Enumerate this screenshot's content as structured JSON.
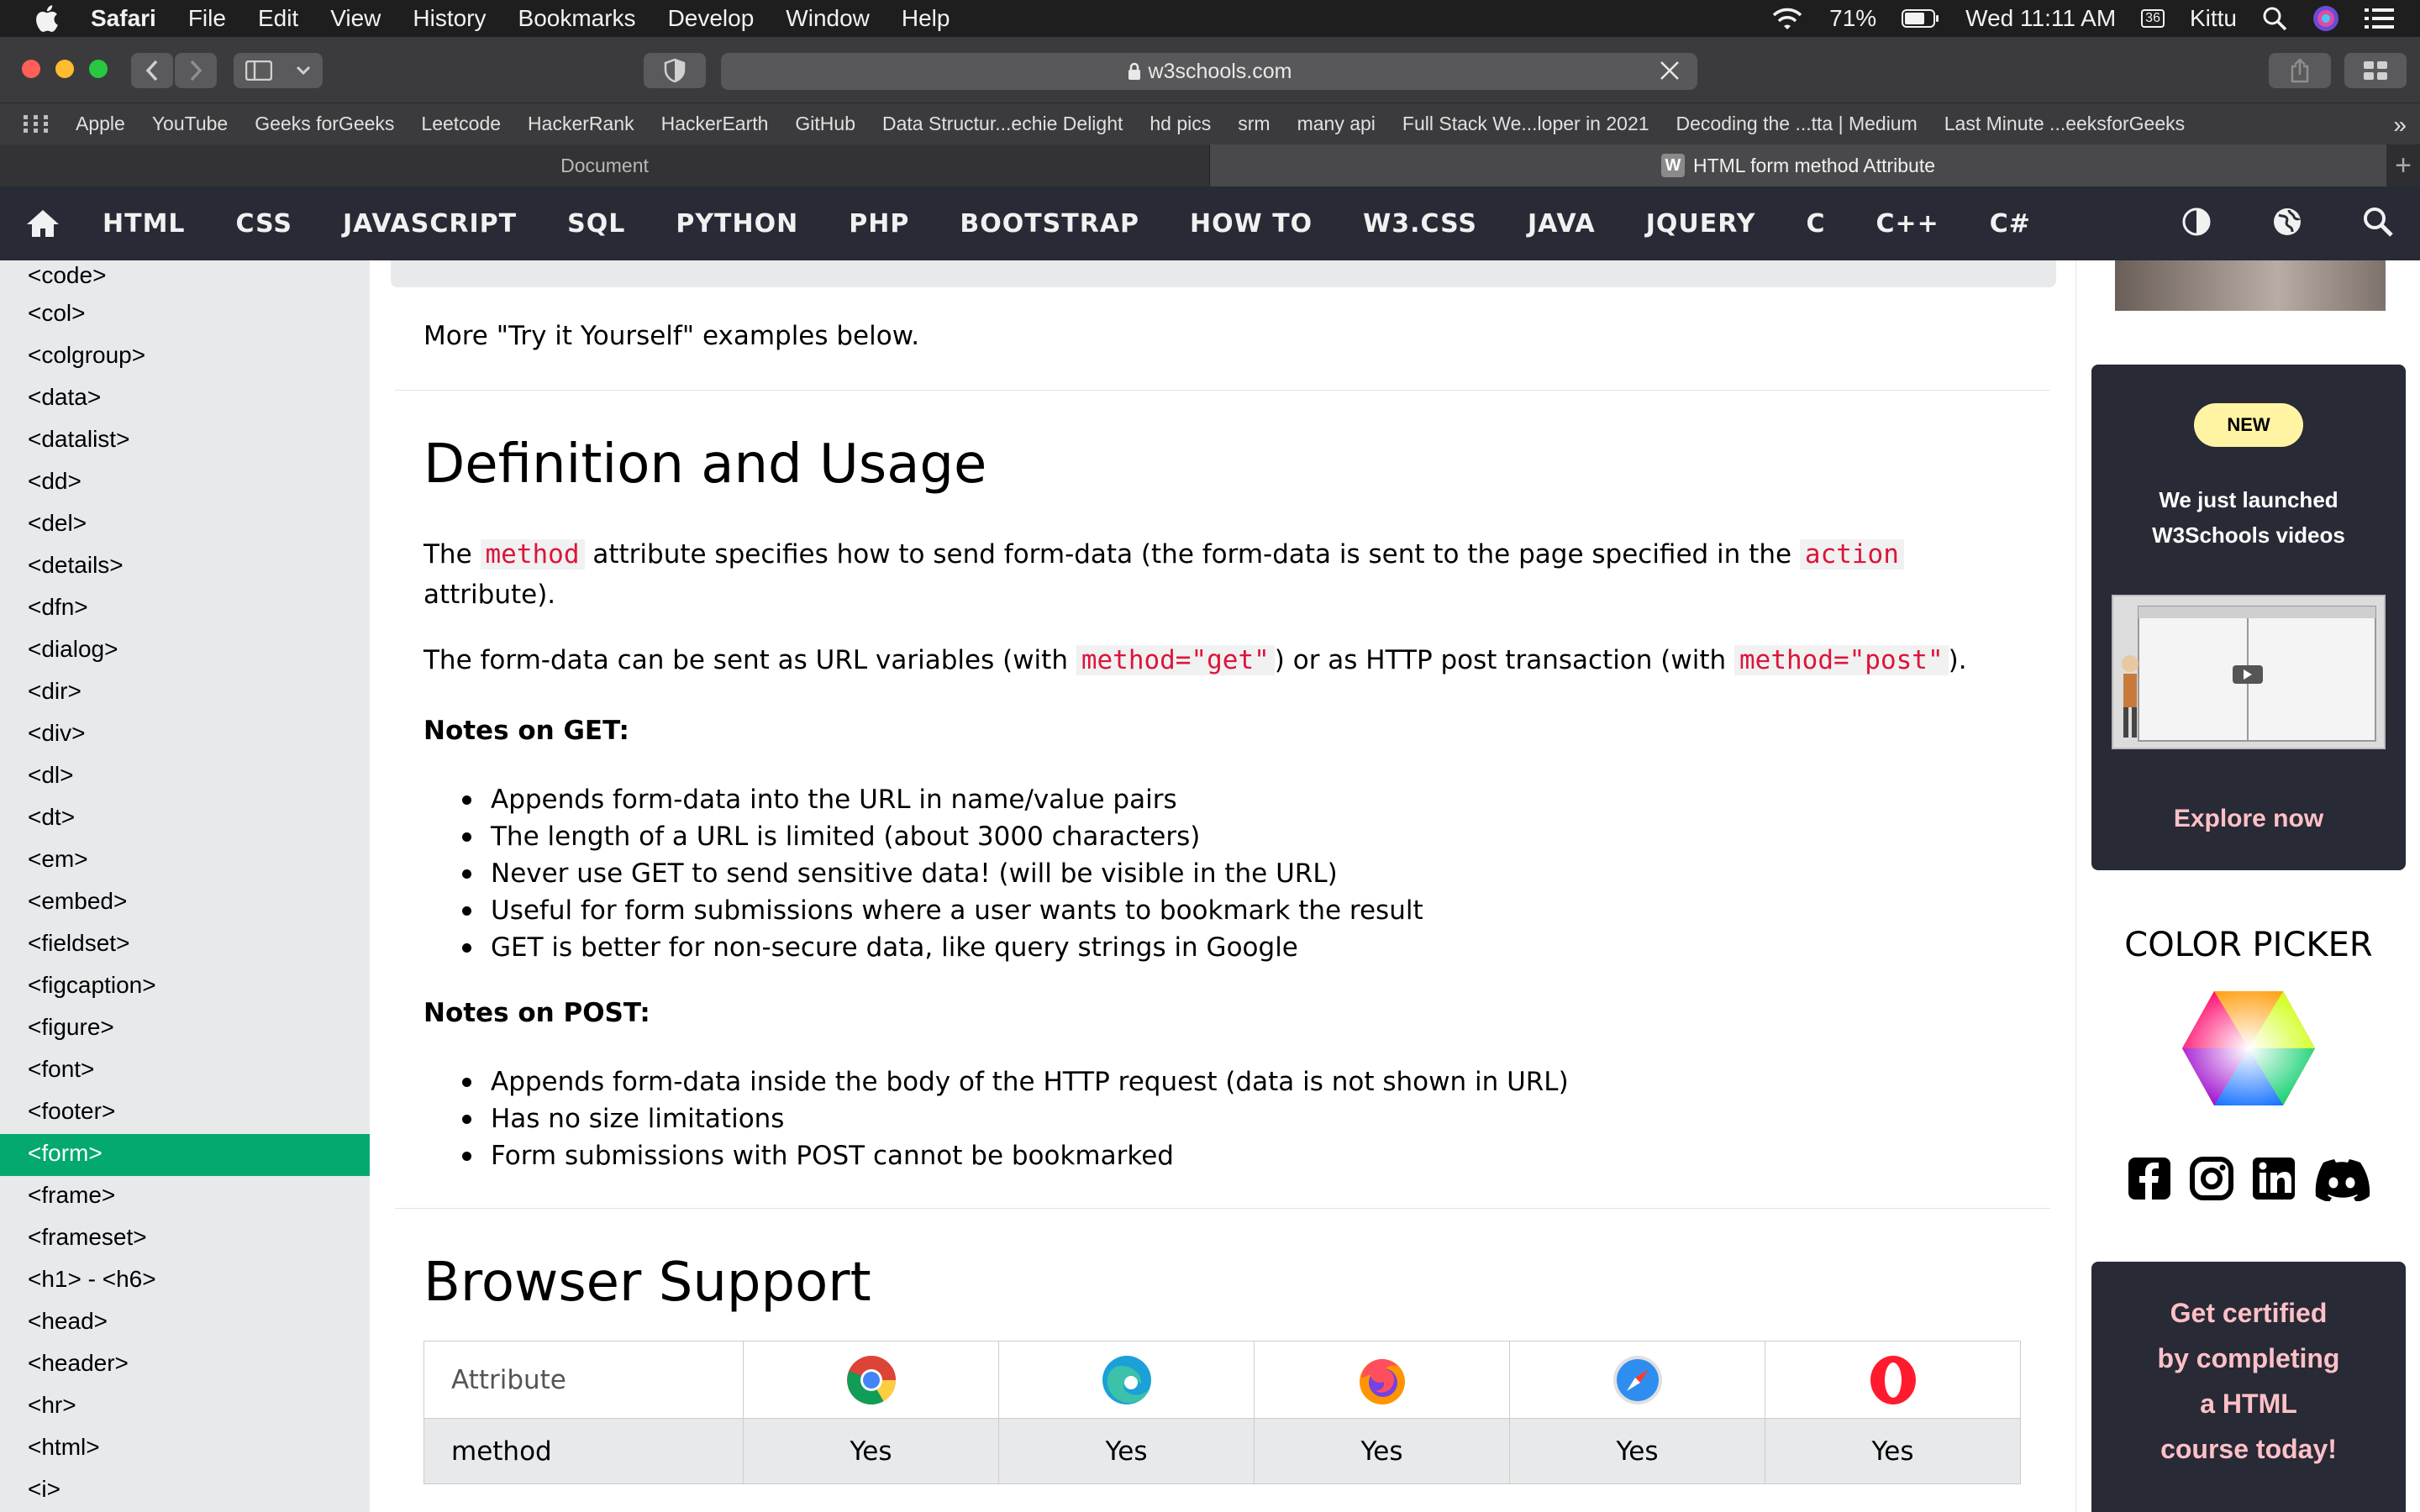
{
  "menubar": {
    "app": "Safari",
    "items": [
      "File",
      "Edit",
      "View",
      "History",
      "Bookmarks",
      "Develop",
      "Window",
      "Help"
    ],
    "battery": "71%",
    "datetime": "Wed 11:11 AM",
    "calendar": "36",
    "user": "Kittu"
  },
  "toolbar": {
    "url": "w3schools.com"
  },
  "bookmarks": [
    "Apple",
    "YouTube",
    "Geeks forGeeks",
    "Leetcode",
    "HackerRank",
    "HackerEarth",
    "GitHub",
    "Data Structur...echie Delight",
    "hd pics",
    "srm",
    "many api",
    "Full Stack We...loper in 2021",
    "Decoding the ...tta | Medium",
    "Last Minute ...eeksforGeeks"
  ],
  "bookmarks_more": "»",
  "tabs": {
    "inactive": "Document",
    "active": "HTML form method Attribute",
    "favicon": "W",
    "new_tab": "+"
  },
  "nav": {
    "items": [
      "HTML",
      "CSS",
      "JAVASCRIPT",
      "SQL",
      "PYTHON",
      "PHP",
      "BOOTSTRAP",
      "HOW TO",
      "W3.CSS",
      "JAVA",
      "JQUERY",
      "C",
      "C++",
      "C#"
    ]
  },
  "sidebar": {
    "items": [
      "<code>",
      "<col>",
      "<colgroup>",
      "<data>",
      "<datalist>",
      "<dd>",
      "<del>",
      "<details>",
      "<dfn>",
      "<dialog>",
      "<dir>",
      "<div>",
      "<dl>",
      "<dt>",
      "<em>",
      "<embed>",
      "<fieldset>",
      "<figcaption>",
      "<figure>",
      "<font>",
      "<footer>",
      "<form>",
      "<frame>",
      "<frameset>",
      "<h1> - <h6>",
      "<head>",
      "<header>",
      "<hr>",
      "<html>",
      "<i>"
    ],
    "active_index": 21
  },
  "main": {
    "more_examples": "More \"Try it Yourself\" examples below.",
    "definition_heading": "Definition and Usage",
    "p1": {
      "a": "The ",
      "code1": "method",
      "b": " attribute specifies how to send form-data (the form-data is sent to the page specified in the ",
      "code2": "action",
      "c": " attribute)."
    },
    "p2": {
      "a": "The form-data can be sent as URL variables (with ",
      "code1": "method=\"get\"",
      "b": ") or as HTTP post transaction (with ",
      "code2": "method=\"post\"",
      "c": ")."
    },
    "get_heading": "Notes on GET:",
    "get_notes": [
      "Appends form-data into the URL in name/value pairs",
      "The length of a URL is limited (about 3000 characters)",
      "Never use GET to send sensitive data! (will be visible in the URL)",
      "Useful for form submissions where a user wants to bookmark the result",
      "GET is better for non-secure data, like query strings in Google"
    ],
    "post_heading": "Notes on POST:",
    "post_notes": [
      "Appends form-data inside the body of the HTTP request (data is not shown in URL)",
      "Has no size limitations",
      "Form submissions with POST cannot be bookmarked"
    ],
    "browser_heading": "Browser Support",
    "table": {
      "header": "Attribute",
      "browsers": [
        "chrome-icon",
        "edge-icon",
        "firefox-icon",
        "safari-icon",
        "opera-icon"
      ],
      "row_name": "method",
      "support": [
        "Yes",
        "Yes",
        "Yes",
        "Yes",
        "Yes"
      ]
    }
  },
  "right": {
    "badge": "NEW",
    "promo_line1": "We just launched",
    "promo_line2": "W3Schools videos",
    "explore": "Explore now",
    "color_picker": "COLOR PICKER",
    "social_icons": [
      "facebook-icon",
      "instagram-icon",
      "linkedin-icon",
      "discord-icon"
    ],
    "cert_lines": [
      "Get certified",
      "by completing",
      "a HTML",
      "course today!"
    ]
  },
  "colors": {
    "nav_bg": "#282a35",
    "active_green": "#04aa6d",
    "code_red": "#dc143c",
    "sidebar_bg": "#e7e9eb",
    "promo_pink": "#ffc0c7",
    "badge_yellow": "#fff4a3"
  }
}
